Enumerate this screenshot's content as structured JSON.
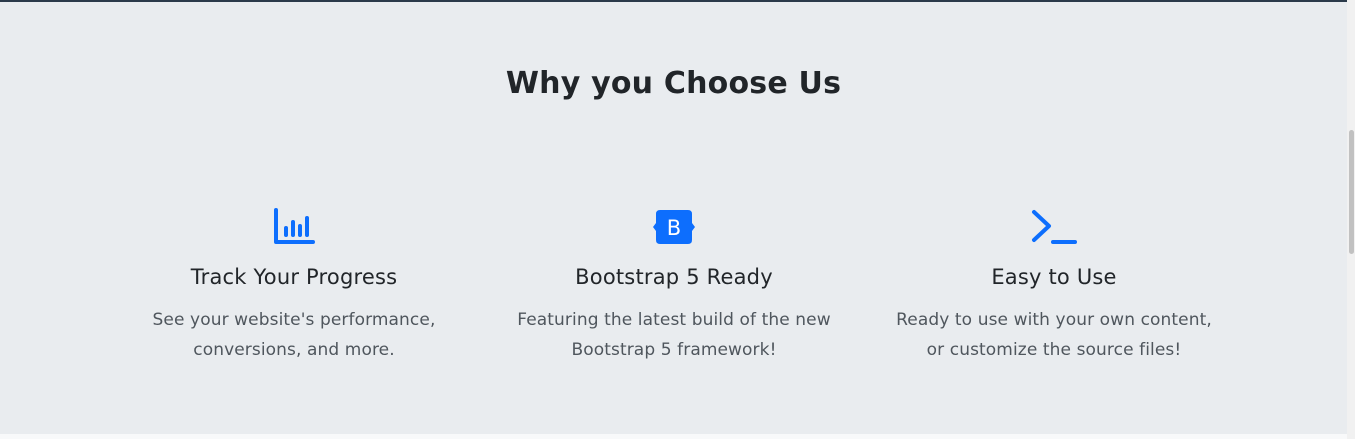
{
  "section": {
    "title": "Why you Choose Us"
  },
  "features": [
    {
      "icon": "bar-chart-icon",
      "title": "Track Your Progress",
      "text_line1": "See your website's performance,",
      "text_line2": "conversions, and more."
    },
    {
      "icon": "bootstrap-icon",
      "icon_letter": "B",
      "title": "Bootstrap 5 Ready",
      "text_line1": "Featuring the latest build of the new",
      "text_line2": "Bootstrap 5 framework!"
    },
    {
      "icon": "terminal-icon",
      "title": "Easy to Use",
      "text_line1": "Ready to use with your own content,",
      "text_line2": "or customize the source files!"
    }
  ],
  "colors": {
    "background": "#e9ecef",
    "accent": "#0d6efd",
    "heading": "#212529",
    "body_text": "#4f565d"
  }
}
